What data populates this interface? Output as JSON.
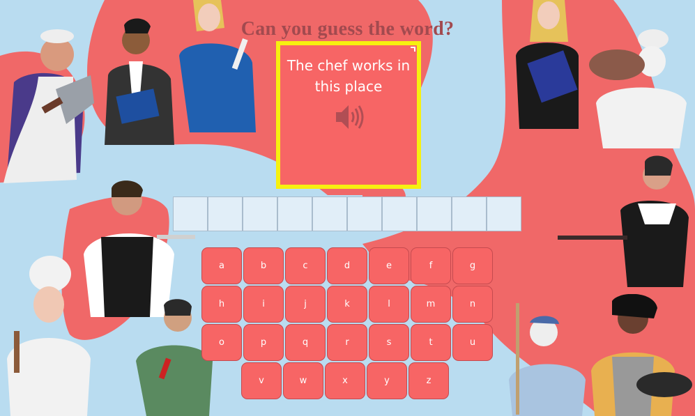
{
  "game": {
    "title": "Can you guess the word?",
    "clue": "The chef works in this place",
    "speaker_icon": "speaker-icon",
    "answer_slots": 10
  },
  "keyboard": {
    "rows": [
      [
        "a",
        "b",
        "c",
        "d",
        "e",
        "f",
        "g"
      ],
      [
        "h",
        "i",
        "j",
        "k",
        "l",
        "m",
        "n"
      ],
      [
        "o",
        "p",
        "q",
        "r",
        "s",
        "t",
        "u"
      ],
      [
        "v",
        "w",
        "x",
        "y",
        "z"
      ]
    ]
  },
  "colors": {
    "background": "#b9dcf0",
    "blob": "#f06868",
    "card": "#f76565",
    "card_border": "#f7f010",
    "title": "#a24a4f",
    "key": "#f76565",
    "slot": "#e1eef8"
  }
}
